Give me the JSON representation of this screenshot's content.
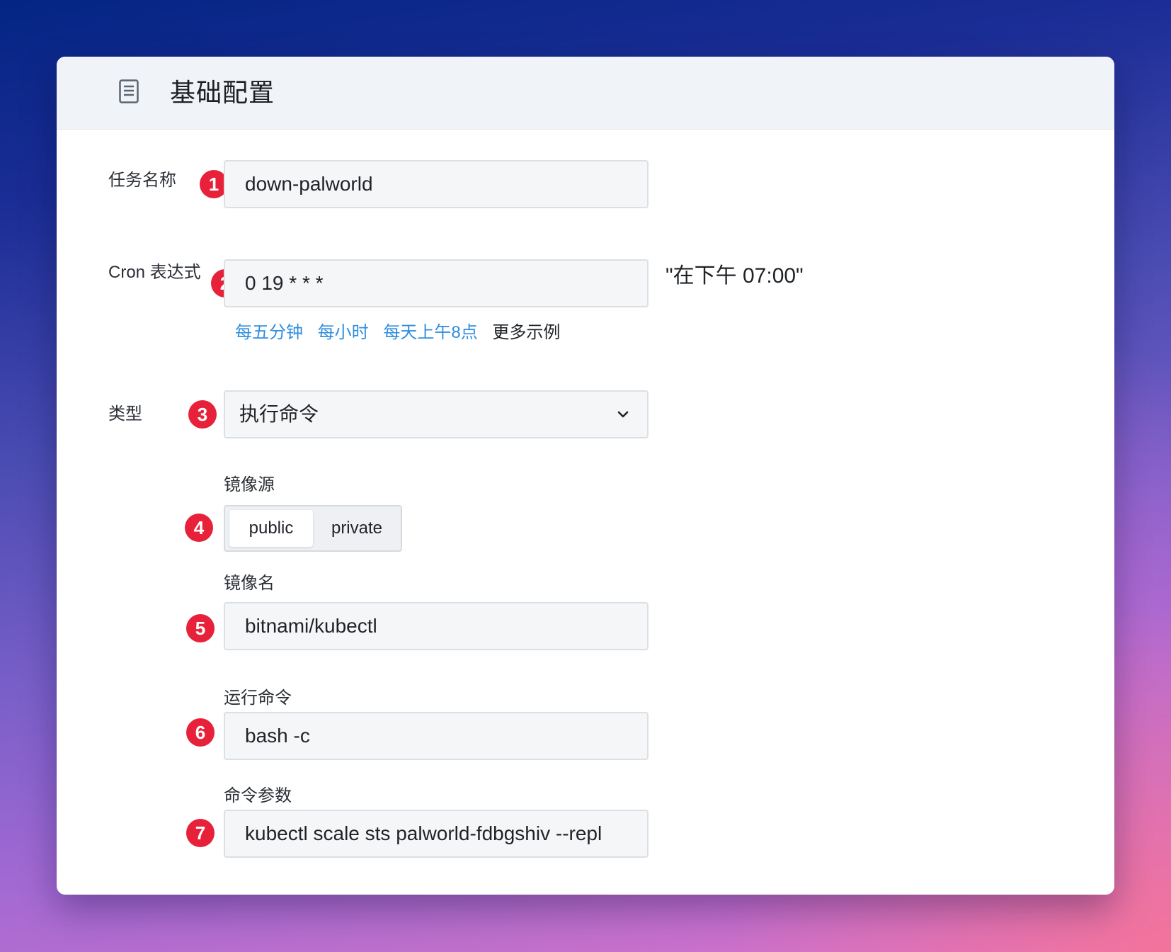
{
  "header": {
    "title": "基础配置",
    "icon": "document-icon"
  },
  "form": {
    "task_name": {
      "label": "任务名称",
      "value": "down-palworld",
      "badge": "1"
    },
    "cron": {
      "label": "Cron 表达式",
      "value": "0 19 * * *",
      "badge": "2",
      "hint": "\"在下午 07:00\"",
      "quick_links": [
        "每五分钟",
        "每小时",
        "每天上午8点"
      ],
      "more_examples": "更多示例"
    },
    "type": {
      "label": "类型",
      "value": "执行命令",
      "badge": "3"
    },
    "image_source": {
      "label": "镜像源",
      "options": [
        "public",
        "private"
      ],
      "selected": "public",
      "badge": "4"
    },
    "image_name": {
      "label": "镜像名",
      "value": "bitnami/kubectl",
      "badge": "5"
    },
    "run_command": {
      "label": "运行命令",
      "value": "bash -c",
      "badge": "6"
    },
    "command_args": {
      "label": "命令参数",
      "value": "kubectl scale sts palworld-fdbgshiv --repl",
      "badge": "7"
    }
  },
  "colors": {
    "badge": "#e8213b",
    "link": "#2f8ee0",
    "header_bg": "#f0f3f7",
    "input_bg": "#f5f6f8"
  }
}
